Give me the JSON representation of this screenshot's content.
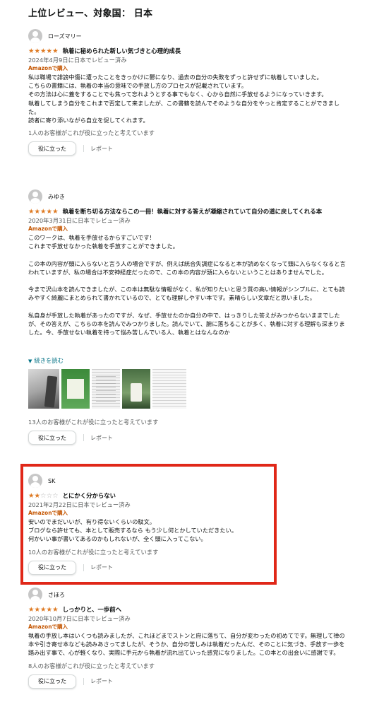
{
  "page": {
    "title": "上位レビュー、対象国： 日本"
  },
  "labels": {
    "helpful_button": "役に立った",
    "report": "レポート",
    "read_more": "続きを読む"
  },
  "colors": {
    "star": "#de7921",
    "badge": "#c45500",
    "link": "#007185",
    "highlight_border": "#e02718"
  },
  "reviews": [
    {
      "name": "ローズマリー",
      "rating": 5,
      "stars": "★★★★★",
      "stars_empty": "",
      "title": "執着に秘められた新しい気づきと心理的成長",
      "date": "2024年4月9日に日本でレビュー済み",
      "badge": "Amazonで購入",
      "body": [
        "私は職場で誹謗中傷に遭ったことをきっかけに鬱になり、過去の自分の失敗をずっと許せずに執着していました。",
        "こちらの書籍には、執着の本当の意味での手放し方のプロセスが記載されています。",
        "その方法は心に蓋をすることでも焦って忘れようとする事でもなく、心から自然に手放せるようになっていきます。",
        "執着してしまう自分をこれまで否定して来ましたが、この書籍を読んでそのような自分をやっと肯定することができました。",
        "読者に寄り添いながら自立を促してくれます。"
      ],
      "helpful": "1人のお客様がこれが役に立ったと考えています"
    },
    {
      "name": "みゆき",
      "rating": 5,
      "stars": "★★★★★",
      "stars_empty": "",
      "title": "執着を断ち切る方法ならこの一冊！執着に対する答えが凝縮されていて自分の道に戻してくれる本",
      "date": "2020年3月31日に日本でレビュー済み",
      "badge": "Amazonで購入",
      "body": [
        "このワークは、執着を手放せるからすごいです！",
        "これまで手放せなかった執着を手放すことができました。",
        "",
        "この本の内容が頭に入らないと言う人の場合ですが、例えば統合失調症になると本が読めなくなって頭に入らなくなると言われていますが、私の場合は不安神経症だったので、この本の内容が頭に入らないということはありませんでした。",
        "",
        "今まで沢山本を読んできましたが、この本は無駄な情報がなく、私が知りたいと思う質の高い情報がシンプルに、とても読みやすく綺麗にまとめられて書かれているので、とても理解しやすい本です。素晴らしい文章だと思いました。",
        "",
        "私自身が手放した執着があったのですが、なぜ、手放せたのか自分の中で、はっきりした答えがみつからないままでしたが、その答えが、こちらの本を読んでみつかりました。読んでいて、腑に落ちることが多く、執着に対する理解も深まりました。今、手放せない執着を持って悩み苦しんでいる人、執着とはなんなのか"
      ],
      "helpful": "13人のお客様がこれが役に立ったと考えています"
    },
    {
      "name": "SK",
      "rating": 2,
      "stars": "★★",
      "stars_empty": "☆☆☆",
      "title": "とにかく分からない",
      "date": "2021年2月22日に日本でレビュー済み",
      "badge": "Amazonで購入",
      "body": [
        "安いのでまだいいが、有り得ないくらいの駄文。",
        "ブログなら許せても、本として販売するなら もう少し何とかしていただきたい。",
        "何かいい事が書いてあるのかもしれないが、全く頭に入ってこない。"
      ],
      "helpful": "10人のお客様がこれが役に立ったと考えています"
    },
    {
      "name": "さほろ",
      "rating": 5,
      "stars": "★★★★★",
      "stars_empty": "",
      "title": "しっかりと、一歩前へ",
      "date": "2020年10月7日に日本でレビュー済み",
      "badge": "Amazonで購入",
      "body": [
        "執着の手放し本はいくつも読みましたが、これほどまでストンと府に落ちて、自分が変わったの初めてです。無理して禅の本や引き寄せ本なども読みあさってましたが、そうか、自分の苦しみは執着だったんだ、そのことに気づき、手放す一歩を踏み出す事で、心が軽くなり、実際に手元から執着が流れ出ていった感覚になりました。この本との出会いに感謝です。"
      ],
      "helpful": "8人のお客様がこれが役に立ったと考えています"
    }
  ]
}
